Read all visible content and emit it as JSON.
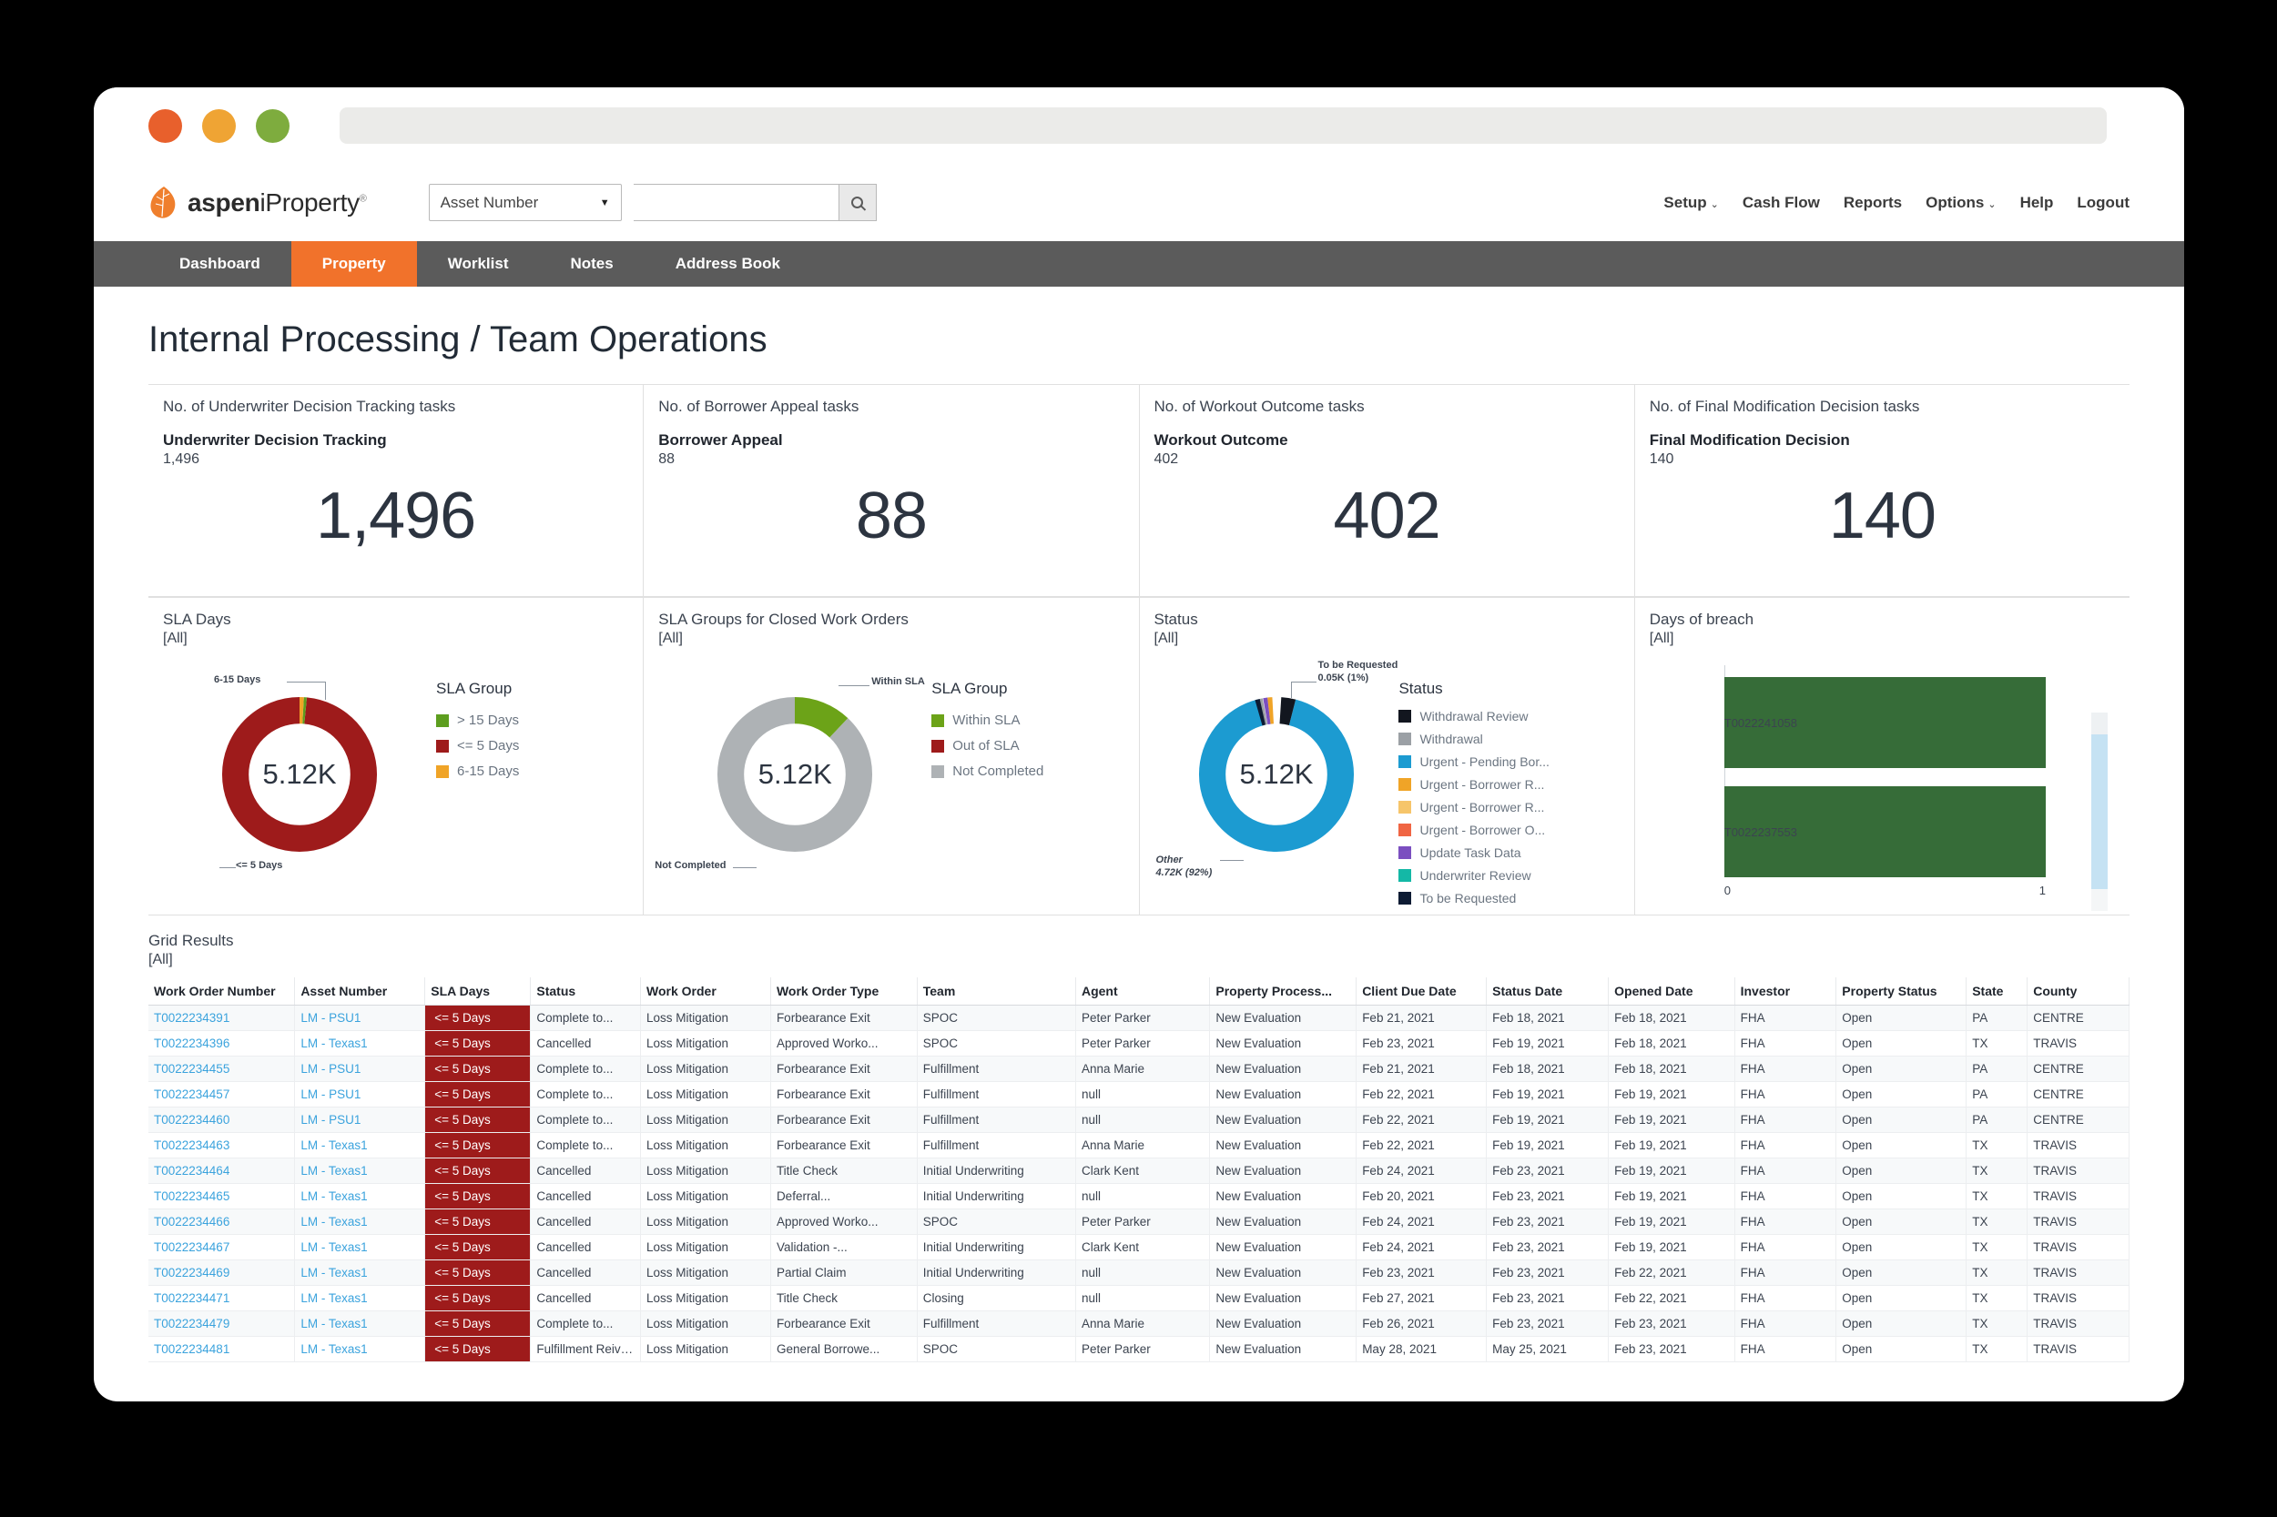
{
  "browser": {
    "dots": [
      "close",
      "minimize",
      "maximize"
    ]
  },
  "app": {
    "logo_bold": "aspen",
    "logo_light": "iProperty",
    "logo_sup": "®",
    "search": {
      "select_value": "Asset Number",
      "input_value": "",
      "placeholder": ""
    },
    "topnav": [
      {
        "label": "Setup",
        "caret": "⌄"
      },
      {
        "label": "Cash Flow",
        "caret": ""
      },
      {
        "label": "Reports",
        "caret": ""
      },
      {
        "label": "Options",
        "caret": "⌄"
      },
      {
        "label": "Help",
        "caret": ""
      },
      {
        "label": "Logout",
        "caret": ""
      }
    ],
    "tabs": [
      {
        "label": "Dashboard",
        "active": false
      },
      {
        "label": "Property",
        "active": true
      },
      {
        "label": "Worklist",
        "active": false
      },
      {
        "label": "Notes",
        "active": false
      },
      {
        "label": "Address Book",
        "active": false
      }
    ]
  },
  "page": {
    "title": "Internal Processing / Team Operations"
  },
  "kpis": [
    {
      "subtitle": "No. of Underwriter Decision Tracking tasks",
      "name": "Underwriter Decision Tracking",
      "small": "1,496",
      "value": "1,496"
    },
    {
      "subtitle": "No. of Borrower Appeal tasks",
      "name": "Borrower Appeal",
      "small": "88",
      "value": "88"
    },
    {
      "subtitle": "No. of Workout Outcome tasks",
      "name": "Workout Outcome",
      "small": "402",
      "value": "402"
    },
    {
      "subtitle": "No. of Final Modification Decision tasks",
      "name": "Final Modification Decision",
      "small": "140",
      "value": "140"
    }
  ],
  "charts": {
    "sla_days": {
      "title": "SLA Days",
      "filter": "[All]",
      "center": "5.12K",
      "legend_title": "SLA Group",
      "callout_top": "6-15 Days",
      "callout_bottom": "<= 5 Days"
    },
    "sla_closed": {
      "title": "SLA Groups for Closed Work Orders",
      "filter": "[All]",
      "center": "5.12K",
      "legend_title": "SLA Group",
      "callout_top": "Within SLA",
      "callout_bottom": "Not Completed"
    },
    "status": {
      "title": "Status",
      "filter": "[All]",
      "center": "5.12K",
      "legend_title": "Status",
      "callout_top": "To be Requested\n0.05K (1%)",
      "callout_bottom": "Other\n4.72K (92%)"
    },
    "breach": {
      "title": "Days of breach",
      "filter": "[All]"
    }
  },
  "chart_data": [
    {
      "type": "pie",
      "title": "SLA Days",
      "subtitle": "[All]",
      "center_label": "5.12K",
      "total": 5120,
      "legend_title": "SLA Group",
      "legend_position": "right",
      "categories": [
        "> 15 Days",
        "<= 5 Days",
        "6-15 Days"
      ],
      "values": [
        30,
        5045,
        45
      ],
      "percentages": [
        0.6,
        98.5,
        0.9
      ],
      "colors": [
        "#5d9e1f",
        "#9e1b1b",
        "#f0a427"
      ],
      "annotations": [
        "6-15 Days",
        "<= 5 Days"
      ]
    },
    {
      "type": "pie",
      "title": "SLA Groups for Closed Work Orders",
      "subtitle": "[All]",
      "center_label": "5.12K",
      "total": 5120,
      "legend_title": "SLA Group",
      "legend_position": "right",
      "categories": [
        "Within SLA",
        "Out of SLA",
        "Not Completed"
      ],
      "values": [
        614,
        0,
        4506
      ],
      "percentages": [
        12,
        0,
        88
      ],
      "colors": [
        "#6ca318",
        "#9e1b1b",
        "#aeb2b5"
      ],
      "annotations": [
        "Within SLA",
        "Not Completed"
      ]
    },
    {
      "type": "pie",
      "title": "Status",
      "subtitle": "[All]",
      "center_label": "5.12K",
      "total": 5120,
      "legend_title": "Status",
      "legend_position": "right",
      "categories": [
        "Withdrawal Review",
        "Withdrawal",
        "Urgent - Pending Bor...",
        "Urgent - Borrower R...",
        "Urgent - Borrower R...",
        "Urgent - Borrower O...",
        "Update Task Data",
        "Underwriter Review",
        "To be Requested"
      ],
      "values": [
        154,
        41,
        4720,
        51,
        26,
        20,
        46,
        10,
        51
      ],
      "colors": [
        "#12161f",
        "#9ba0a5",
        "#1c9bd1",
        "#f0a427",
        "#f6c56a",
        "#f06543",
        "#7b4fc0",
        "#14b8a6",
        "#0d1b33"
      ],
      "annotations": [
        "To be Requested 0.05K (1%)",
        "Other 4.72K (92%)"
      ]
    },
    {
      "type": "bar",
      "orientation": "horizontal",
      "title": "Days of breach",
      "subtitle": "[All]",
      "categories": [
        "T0022241058",
        "T0022237553"
      ],
      "values": [
        1,
        1
      ],
      "xlim": [
        0,
        1
      ],
      "xticks": [
        "0",
        "1"
      ],
      "color": "#366c38",
      "grid": false
    }
  ],
  "grid": {
    "title": "Grid Results",
    "filter": "[All]",
    "columns": [
      "Work Order Number",
      "Asset Number",
      "SLA Days",
      "Status",
      "Work Order",
      "Work Order Type",
      "Team",
      "Agent",
      "Property Process...",
      "Client Due Date",
      "Status Date",
      "Opened Date",
      "Investor",
      "Property Status",
      "State",
      "County"
    ],
    "rows": [
      [
        "T0022234391",
        "LM - PSU1",
        "<= 5 Days",
        "Complete to...",
        "Loss Mitigation",
        "Forbearance Exit",
        "SPOC",
        "Peter Parker",
        "New Evaluation",
        "Feb 21, 2021",
        "Feb 18, 2021",
        "Feb 18, 2021",
        "FHA",
        "Open",
        "PA",
        "CENTRE"
      ],
      [
        "T0022234396",
        "LM - Texas1",
        "<= 5 Days",
        "Cancelled",
        "Loss Mitigation",
        "Approved Worko...",
        "SPOC",
        "Peter Parker",
        "New Evaluation",
        "Feb 23, 2021",
        "Feb 19, 2021",
        "Feb 18, 2021",
        "FHA",
        "Open",
        "TX",
        "TRAVIS"
      ],
      [
        "T0022234455",
        "LM - PSU1",
        "<= 5 Days",
        "Complete to...",
        "Loss Mitigation",
        "Forbearance Exit",
        "Fulfillment",
        "Anna Marie",
        "New Evaluation",
        "Feb 21, 2021",
        "Feb 18, 2021",
        "Feb 18, 2021",
        "FHA",
        "Open",
        "PA",
        "CENTRE"
      ],
      [
        "T0022234457",
        "LM - PSU1",
        "<= 5 Days",
        "Complete to...",
        "Loss Mitigation",
        "Forbearance Exit",
        "Fulfillment",
        "null",
        "New Evaluation",
        "Feb 22, 2021",
        "Feb 19, 2021",
        "Feb 19, 2021",
        "FHA",
        "Open",
        "PA",
        "CENTRE"
      ],
      [
        "T0022234460",
        "LM - PSU1",
        "<= 5 Days",
        "Complete to...",
        "Loss Mitigation",
        "Forbearance Exit",
        "Fulfillment",
        "null",
        "New Evaluation",
        "Feb 22, 2021",
        "Feb 19, 2021",
        "Feb 19, 2021",
        "FHA",
        "Open",
        "PA",
        "CENTRE"
      ],
      [
        "T0022234463",
        "LM - Texas1",
        "<= 5 Days",
        "Complete to...",
        "Loss Mitigation",
        "Forbearance Exit",
        "Fulfillment",
        "Anna Marie",
        "New Evaluation",
        "Feb 22, 2021",
        "Feb 19, 2021",
        "Feb 19, 2021",
        "FHA",
        "Open",
        "TX",
        "TRAVIS"
      ],
      [
        "T0022234464",
        "LM - Texas1",
        "<= 5 Days",
        "Cancelled",
        "Loss Mitigation",
        "Title Check",
        "Initial Underwriting",
        "Clark Kent",
        "New Evaluation",
        "Feb 24, 2021",
        "Feb 23, 2021",
        "Feb 19, 2021",
        "FHA",
        "Open",
        "TX",
        "TRAVIS"
      ],
      [
        "T0022234465",
        "LM - Texas1",
        "<= 5 Days",
        "Cancelled",
        "Loss Mitigation",
        "Deferral...",
        "Initial Underwriting",
        "null",
        "New Evaluation",
        "Feb 20, 2021",
        "Feb 23, 2021",
        "Feb 19, 2021",
        "FHA",
        "Open",
        "TX",
        "TRAVIS"
      ],
      [
        "T0022234466",
        "LM - Texas1",
        "<= 5 Days",
        "Cancelled",
        "Loss Mitigation",
        "Approved Worko...",
        "SPOC",
        "Peter Parker",
        "New Evaluation",
        "Feb 24, 2021",
        "Feb 23, 2021",
        "Feb 19, 2021",
        "FHA",
        "Open",
        "TX",
        "TRAVIS"
      ],
      [
        "T0022234467",
        "LM - Texas1",
        "<= 5 Days",
        "Cancelled",
        "Loss Mitigation",
        "Validation -...",
        "Initial Underwriting",
        "Clark Kent",
        "New Evaluation",
        "Feb 24, 2021",
        "Feb 23, 2021",
        "Feb 19, 2021",
        "FHA",
        "Open",
        "TX",
        "TRAVIS"
      ],
      [
        "T0022234469",
        "LM - Texas1",
        "<= 5 Days",
        "Cancelled",
        "Loss Mitigation",
        "Partial Claim",
        "Initial Underwriting",
        "null",
        "New Evaluation",
        "Feb 23, 2021",
        "Feb 23, 2021",
        "Feb 22, 2021",
        "FHA",
        "Open",
        "TX",
        "TRAVIS"
      ],
      [
        "T0022234471",
        "LM - Texas1",
        "<= 5 Days",
        "Cancelled",
        "Loss Mitigation",
        "Title Check",
        "Closing",
        "null",
        "New Evaluation",
        "Feb 27, 2021",
        "Feb 23, 2021",
        "Feb 22, 2021",
        "FHA",
        "Open",
        "TX",
        "TRAVIS"
      ],
      [
        "T0022234479",
        "LM - Texas1",
        "<= 5 Days",
        "Complete to...",
        "Loss Mitigation",
        "Forbearance Exit",
        "Fulfillment",
        "Anna Marie",
        "New Evaluation",
        "Feb 26, 2021",
        "Feb 23, 2021",
        "Feb 23, 2021",
        "FHA",
        "Open",
        "TX",
        "TRAVIS"
      ],
      [
        "T0022234481",
        "LM - Texas1",
        "<= 5 Days",
        "Fulfillment Reivew",
        "Loss Mitigation",
        "General Borrowe...",
        "SPOC",
        "Peter Parker",
        "New Evaluation",
        "May 28, 2021",
        "May 25, 2021",
        "Feb 23, 2021",
        "FHA",
        "Open",
        "TX",
        "TRAVIS"
      ]
    ]
  }
}
